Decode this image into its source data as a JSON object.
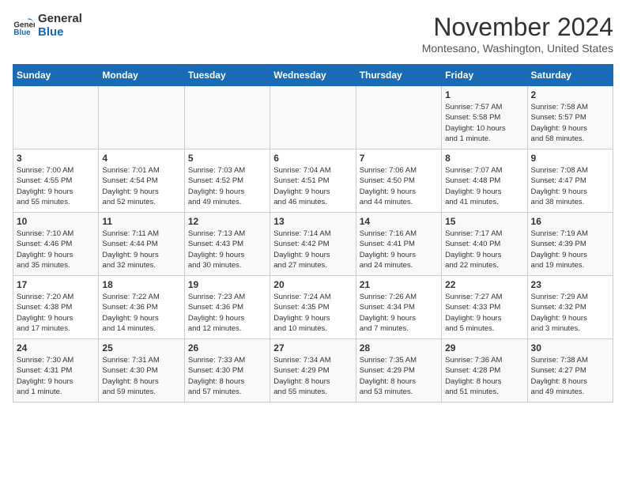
{
  "header": {
    "logo_line1": "General",
    "logo_line2": "Blue",
    "month_title": "November 2024",
    "location": "Montesano, Washington, United States"
  },
  "days_of_week": [
    "Sunday",
    "Monday",
    "Tuesday",
    "Wednesday",
    "Thursday",
    "Friday",
    "Saturday"
  ],
  "weeks": [
    [
      {
        "day": "",
        "info": ""
      },
      {
        "day": "",
        "info": ""
      },
      {
        "day": "",
        "info": ""
      },
      {
        "day": "",
        "info": ""
      },
      {
        "day": "",
        "info": ""
      },
      {
        "day": "1",
        "info": "Sunrise: 7:57 AM\nSunset: 5:58 PM\nDaylight: 10 hours\nand 1 minute."
      },
      {
        "day": "2",
        "info": "Sunrise: 7:58 AM\nSunset: 5:57 PM\nDaylight: 9 hours\nand 58 minutes."
      }
    ],
    [
      {
        "day": "3",
        "info": "Sunrise: 7:00 AM\nSunset: 4:55 PM\nDaylight: 9 hours\nand 55 minutes."
      },
      {
        "day": "4",
        "info": "Sunrise: 7:01 AM\nSunset: 4:54 PM\nDaylight: 9 hours\nand 52 minutes."
      },
      {
        "day": "5",
        "info": "Sunrise: 7:03 AM\nSunset: 4:52 PM\nDaylight: 9 hours\nand 49 minutes."
      },
      {
        "day": "6",
        "info": "Sunrise: 7:04 AM\nSunset: 4:51 PM\nDaylight: 9 hours\nand 46 minutes."
      },
      {
        "day": "7",
        "info": "Sunrise: 7:06 AM\nSunset: 4:50 PM\nDaylight: 9 hours\nand 44 minutes."
      },
      {
        "day": "8",
        "info": "Sunrise: 7:07 AM\nSunset: 4:48 PM\nDaylight: 9 hours\nand 41 minutes."
      },
      {
        "day": "9",
        "info": "Sunrise: 7:08 AM\nSunset: 4:47 PM\nDaylight: 9 hours\nand 38 minutes."
      }
    ],
    [
      {
        "day": "10",
        "info": "Sunrise: 7:10 AM\nSunset: 4:46 PM\nDaylight: 9 hours\nand 35 minutes."
      },
      {
        "day": "11",
        "info": "Sunrise: 7:11 AM\nSunset: 4:44 PM\nDaylight: 9 hours\nand 32 minutes."
      },
      {
        "day": "12",
        "info": "Sunrise: 7:13 AM\nSunset: 4:43 PM\nDaylight: 9 hours\nand 30 minutes."
      },
      {
        "day": "13",
        "info": "Sunrise: 7:14 AM\nSunset: 4:42 PM\nDaylight: 9 hours\nand 27 minutes."
      },
      {
        "day": "14",
        "info": "Sunrise: 7:16 AM\nSunset: 4:41 PM\nDaylight: 9 hours\nand 24 minutes."
      },
      {
        "day": "15",
        "info": "Sunrise: 7:17 AM\nSunset: 4:40 PM\nDaylight: 9 hours\nand 22 minutes."
      },
      {
        "day": "16",
        "info": "Sunrise: 7:19 AM\nSunset: 4:39 PM\nDaylight: 9 hours\nand 19 minutes."
      }
    ],
    [
      {
        "day": "17",
        "info": "Sunrise: 7:20 AM\nSunset: 4:38 PM\nDaylight: 9 hours\nand 17 minutes."
      },
      {
        "day": "18",
        "info": "Sunrise: 7:22 AM\nSunset: 4:36 PM\nDaylight: 9 hours\nand 14 minutes."
      },
      {
        "day": "19",
        "info": "Sunrise: 7:23 AM\nSunset: 4:36 PM\nDaylight: 9 hours\nand 12 minutes."
      },
      {
        "day": "20",
        "info": "Sunrise: 7:24 AM\nSunset: 4:35 PM\nDaylight: 9 hours\nand 10 minutes."
      },
      {
        "day": "21",
        "info": "Sunrise: 7:26 AM\nSunset: 4:34 PM\nDaylight: 9 hours\nand 7 minutes."
      },
      {
        "day": "22",
        "info": "Sunrise: 7:27 AM\nSunset: 4:33 PM\nDaylight: 9 hours\nand 5 minutes."
      },
      {
        "day": "23",
        "info": "Sunrise: 7:29 AM\nSunset: 4:32 PM\nDaylight: 9 hours\nand 3 minutes."
      }
    ],
    [
      {
        "day": "24",
        "info": "Sunrise: 7:30 AM\nSunset: 4:31 PM\nDaylight: 9 hours\nand 1 minute."
      },
      {
        "day": "25",
        "info": "Sunrise: 7:31 AM\nSunset: 4:30 PM\nDaylight: 8 hours\nand 59 minutes."
      },
      {
        "day": "26",
        "info": "Sunrise: 7:33 AM\nSunset: 4:30 PM\nDaylight: 8 hours\nand 57 minutes."
      },
      {
        "day": "27",
        "info": "Sunrise: 7:34 AM\nSunset: 4:29 PM\nDaylight: 8 hours\nand 55 minutes."
      },
      {
        "day": "28",
        "info": "Sunrise: 7:35 AM\nSunset: 4:29 PM\nDaylight: 8 hours\nand 53 minutes."
      },
      {
        "day": "29",
        "info": "Sunrise: 7:36 AM\nSunset: 4:28 PM\nDaylight: 8 hours\nand 51 minutes."
      },
      {
        "day": "30",
        "info": "Sunrise: 7:38 AM\nSunset: 4:27 PM\nDaylight: 8 hours\nand 49 minutes."
      }
    ]
  ]
}
